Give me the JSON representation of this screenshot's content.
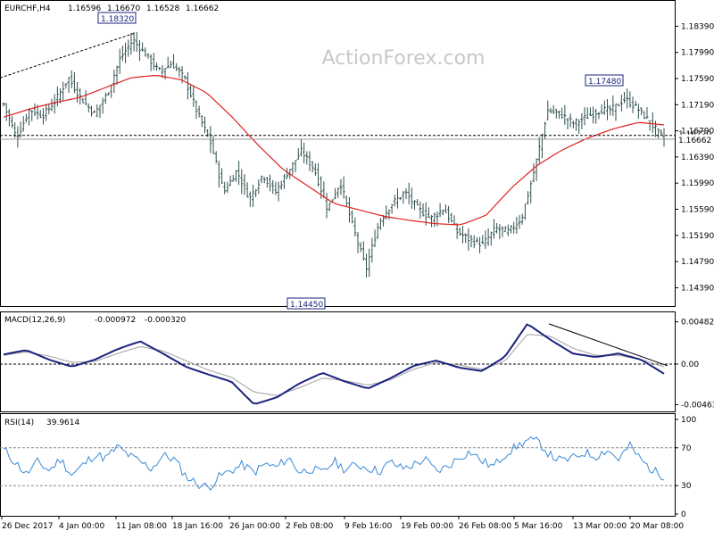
{
  "chart_data": [
    {
      "type": "ohlc-bar",
      "title": "EURCHF,H4",
      "header_values": [
        "1.16596",
        "1.16670",
        "1.16528",
        "1.16662"
      ],
      "ylim": [
        1.1415,
        1.186
      ],
      "yticks": [
        "1.18390",
        "1.17990",
        "1.17590",
        "1.17190",
        "1.16790",
        "1.16390",
        "1.15990",
        "1.15590",
        "1.15190",
        "1.14790",
        "1.14390"
      ],
      "xticks": [
        "26 Dec 2017",
        "4 Jan 00:00",
        "11 Jan 08:00",
        "18 Jan 16:00",
        "26 Jan 00:00",
        "2 Feb 08:00",
        "9 Feb 16:00",
        "19 Feb 00:00",
        "26 Feb 08:00",
        "5 Mar 16:00",
        "13 Mar 00:00",
        "20 Mar 08:00"
      ],
      "close_path": [
        1.172,
        1.1668,
        1.1712,
        1.1702,
        1.1725,
        1.176,
        1.1728,
        1.1705,
        1.1735,
        1.179,
        1.1818,
        1.1795,
        1.177,
        1.1782,
        1.1758,
        1.1705,
        1.166,
        1.1585,
        1.1618,
        1.1575,
        1.1612,
        1.1585,
        1.1618,
        1.1648,
        1.162,
        1.156,
        1.16,
        1.153,
        1.1468,
        1.154,
        1.1568,
        1.1585,
        1.156,
        1.1545,
        1.156,
        1.1525,
        1.1512,
        1.1505,
        1.153,
        1.1525,
        1.1545,
        1.162,
        1.171,
        1.1705,
        1.169,
        1.17,
        1.171,
        1.1712,
        1.1728,
        1.1712,
        1.169,
        1.1666
      ],
      "ma_path": [
        1.17,
        1.1712,
        1.1722,
        1.173,
        1.1745,
        1.176,
        1.1764,
        1.1757,
        1.1737,
        1.17,
        1.1658,
        1.162,
        1.1594,
        1.1568,
        1.1558,
        1.1548,
        1.1542,
        1.1537,
        1.1535,
        1.155,
        1.1592,
        1.1626,
        1.165,
        1.1668,
        1.1682,
        1.1692,
        1.1688
      ],
      "annotations": [
        "1.18320",
        "1.17480",
        "1.14450"
      ],
      "price_labels": [
        "1.16720",
        "1.16662"
      ],
      "watermark": "ActionForex.com"
    },
    {
      "type": "line",
      "title": "MACD(12,26,9)",
      "header_values": [
        "-0.000972",
        "-0.000320"
      ],
      "ylim": [
        -0.0052,
        0.0054
      ],
      "yticks": [
        "0.004827",
        "0.00",
        "-0.004632"
      ],
      "macd": [
        0.0011,
        0.0016,
        0.0005,
        -0.0003,
        0.0005,
        0.0017,
        0.0026,
        0.0012,
        -0.0003,
        -0.0012,
        -0.002,
        -0.0046,
        -0.0038,
        -0.0022,
        -0.001,
        -0.002,
        -0.0028,
        -0.0016,
        -0.0002,
        0.0004,
        -0.0004,
        -0.0008,
        0.0008,
        0.0046,
        0.0028,
        0.0012,
        0.0008,
        0.0012,
        0.0005,
        -0.0011
      ],
      "signal": [
        0.001,
        0.0014,
        0.0009,
        0.0002,
        0.0003,
        0.0012,
        0.002,
        0.0015,
        0.0004,
        -0.0007,
        -0.0015,
        -0.0032,
        -0.0036,
        -0.0027,
        -0.0016,
        -0.0019,
        -0.0024,
        -0.0018,
        -0.0006,
        0.0002,
        -0.0001,
        -0.0006,
        0.0003,
        0.0034,
        0.0032,
        0.0018,
        0.001,
        0.001,
        0.0005,
        -0.0003
      ]
    },
    {
      "type": "line",
      "title": "RSI(14)",
      "header_values": [
        "39.9614"
      ],
      "ylim": [
        0,
        100
      ],
      "yticks": [
        "100",
        "70",
        "30",
        "0"
      ],
      "levels": [
        70,
        30
      ],
      "values": [
        68,
        55,
        42,
        55,
        46,
        58,
        41,
        52,
        63,
        59,
        71,
        62,
        55,
        48,
        62,
        58,
        40,
        32,
        28,
        40,
        46,
        52,
        44,
        53,
        49,
        60,
        44,
        48,
        43,
        56,
        47,
        52,
        49,
        45,
        55,
        48,
        52,
        58,
        45,
        50,
        60,
        66,
        56,
        50,
        63,
        71,
        78,
        76,
        62,
        56,
        59,
        65,
        61,
        68,
        58,
        72,
        57,
        46,
        40
      ]
    }
  ]
}
